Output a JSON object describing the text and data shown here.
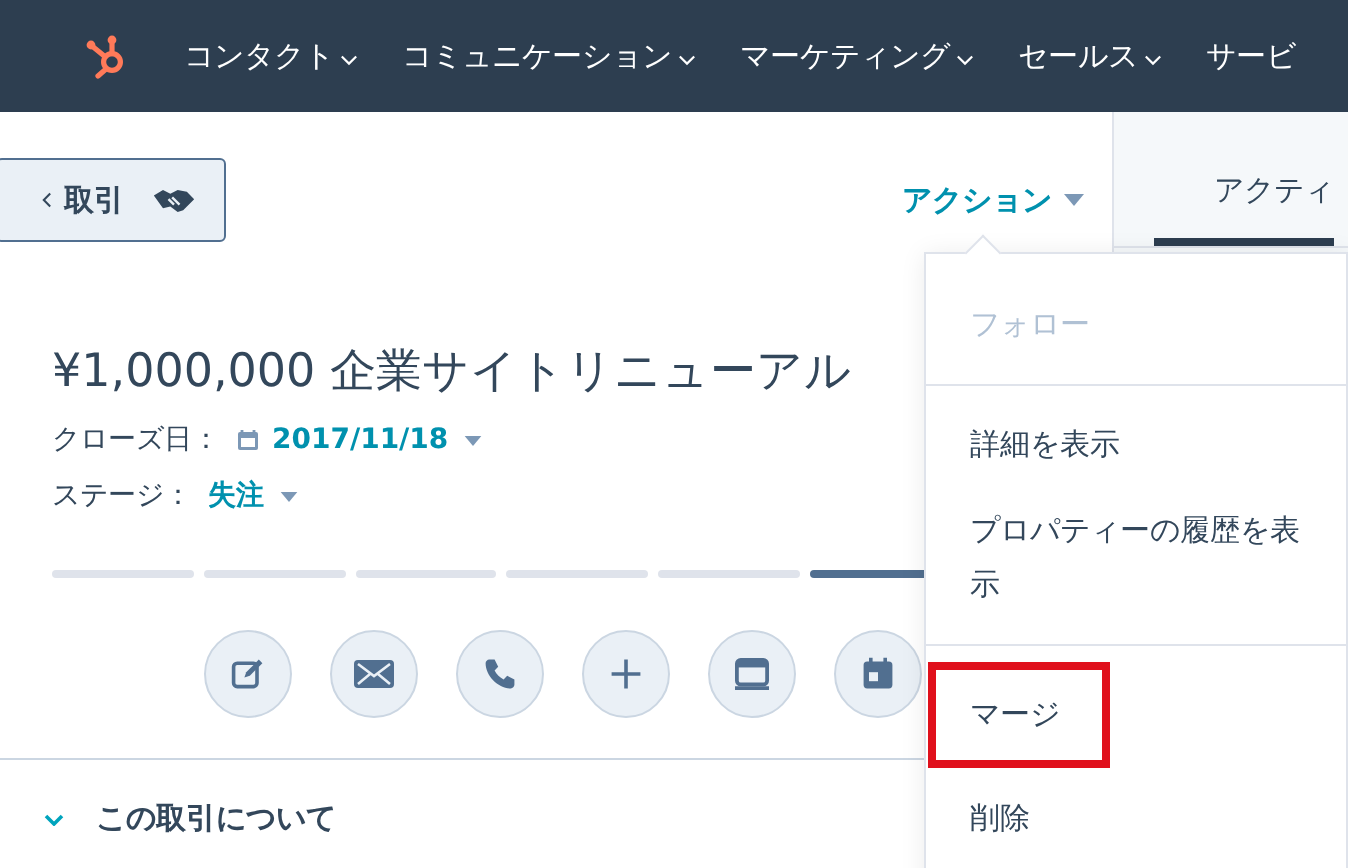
{
  "nav": {
    "items": [
      {
        "label": "コンタクト",
        "dropdown": true
      },
      {
        "label": "コミュニケーション",
        "dropdown": true
      },
      {
        "label": "マーケティング",
        "dropdown": true
      },
      {
        "label": "セールス",
        "dropdown": true
      },
      {
        "label": "サービ",
        "dropdown": false
      }
    ]
  },
  "back_button": {
    "label": "取引"
  },
  "actions_button": {
    "label": "アクション"
  },
  "tabs": [
    {
      "label": "アクティ",
      "selected": true
    }
  ],
  "record": {
    "title": "¥1,000,000 企業サイトリニューアル",
    "close_date": {
      "label": "クローズ日：",
      "value": "2017/11/18"
    },
    "stage": {
      "label": "ステージ：",
      "value": "失注"
    },
    "stages": [
      {
        "done": false
      },
      {
        "done": false
      },
      {
        "done": false
      },
      {
        "done": false
      },
      {
        "done": false
      },
      {
        "done": true
      }
    ],
    "quick_actions": [
      {
        "kind": "note"
      },
      {
        "kind": "email"
      },
      {
        "kind": "call"
      },
      {
        "kind": "add"
      },
      {
        "kind": "log"
      },
      {
        "kind": "meeting"
      }
    ]
  },
  "section": {
    "label": "この取引について",
    "expanded": true
  },
  "menu": {
    "items": [
      {
        "label": "フォロー",
        "disabled": true,
        "highlighted": false,
        "divider_after": true
      },
      {
        "label": "詳細を表示",
        "disabled": false,
        "highlighted": false,
        "divider_after": false
      },
      {
        "label": "プロパティーの履歴を表示",
        "disabled": false,
        "highlighted": false,
        "divider_after": true
      },
      {
        "label": "マージ",
        "disabled": false,
        "highlighted": true,
        "divider_after": false
      },
      {
        "label": "削除",
        "disabled": false,
        "highlighted": false,
        "divider_after": false
      }
    ]
  }
}
